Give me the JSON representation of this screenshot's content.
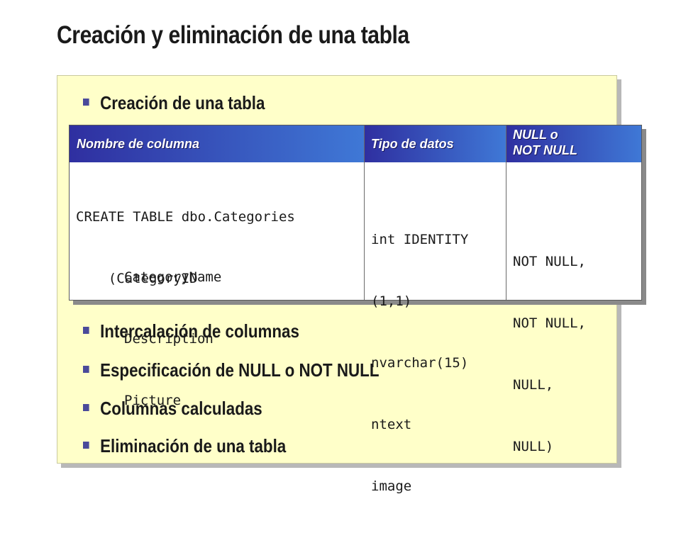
{
  "slide": {
    "title": "Creación y eliminación de una tabla"
  },
  "bullets": {
    "first": "Creación de una tabla",
    "rest": [
      "Intercalación de columnas",
      "Especificación de NULL o NOT NULL",
      "Columnas calculadas",
      "Eliminación de una tabla"
    ]
  },
  "table": {
    "headers": {
      "column_name": "Nombre de columna",
      "data_type": "Tipo de datos",
      "nullability_line1": "NULL o",
      "nullability_line2": "NOT NULL"
    },
    "names": {
      "line1": "CREATE TABLE dbo.Categories",
      "line2": "    (CategoryID",
      "line3": "CategoryName",
      "line4": "Description",
      "line5": "Picture"
    },
    "types": [
      "int IDENTITY",
      "(1,1)",
      "nvarchar(15)",
      "ntext",
      "image"
    ],
    "nulls": [
      "NOT NULL,",
      "NOT NULL,",
      "NULL,",
      "NULL)"
    ]
  },
  "colors": {
    "panel_background": "#ffffc9",
    "header_gradient_start": "#2f2fa0",
    "header_gradient_end": "#3f78d6",
    "bullet_mark": "#4a4a9a"
  }
}
